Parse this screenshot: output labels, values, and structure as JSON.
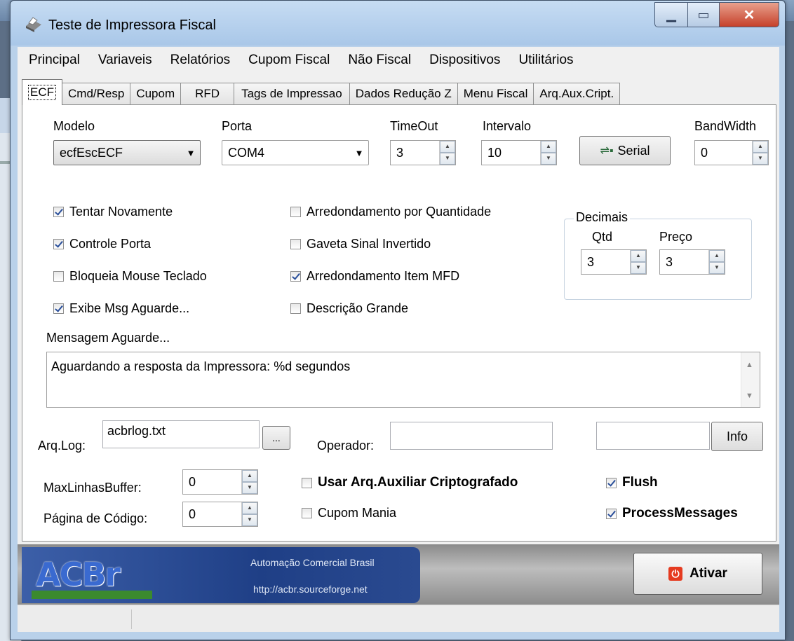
{
  "window": {
    "title": "Teste de Impressora Fiscal"
  },
  "menu": [
    "Principal",
    "Variaveis",
    "Relatórios",
    "Cupom Fiscal",
    "Não Fiscal",
    "Dispositivos",
    "Utilitários"
  ],
  "tabs": [
    "ECF",
    "Cmd/Resp",
    "Cupom",
    "RFD",
    "Tags de Impressao",
    "Dados Redução Z",
    "Menu Fiscal",
    "Arq.Aux.Cript."
  ],
  "ecf": {
    "modelo_label": "Modelo",
    "modelo_value": "ecfEscECF",
    "porta_label": "Porta",
    "porta_value": "COM4",
    "timeout_label": "TimeOut",
    "timeout_value": "3",
    "intervalo_label": "Intervalo",
    "intervalo_value": "10",
    "serial_button": "Serial",
    "bandwidth_label": "BandWidth",
    "bandwidth_value": "0",
    "checks": {
      "tentar": "Tentar Novamente",
      "controle": "Controle Porta",
      "bloqueia": "Bloqueia Mouse Teclado",
      "exibe": "Exibe Msg Aguarde...",
      "arred_qtd": "Arredondamento por Quantidade",
      "gaveta": "Gaveta Sinal Invertido",
      "arred_mfd": "Arredondamento Item MFD",
      "descricao": "Descrição Grande"
    },
    "decimais": {
      "title": "Decimais",
      "qtd_label": "Qtd",
      "qtd_value": "3",
      "preco_label": "Preço",
      "preco_value": "3"
    },
    "mensagem_label": "Mensagem Aguarde...",
    "mensagem_value": "Aguardando a resposta da Impressora: %d segundos",
    "arqlog_label": "Arq.Log:",
    "arqlog_value": "acbrlog.txt",
    "browse_button": "...",
    "operador_label": "Operador:",
    "operador_value": "",
    "info_value": "",
    "info_button": "Info",
    "maxlinhas_label": "MaxLinhasBuffer:",
    "maxlinhas_value": "0",
    "pagina_label": "Página de Código:",
    "pagina_value": "0",
    "usar_arq": "Usar Arq.Auxiliar Criptografado",
    "cupom_mania": "Cupom Mania",
    "flush": "Flush",
    "process": "ProcessMessages"
  },
  "footer": {
    "logo_text": "ACBr",
    "logo_line1": "Automação Comercial Brasil",
    "logo_line2": "http://acbr.sourceforge.net",
    "ativar_button": "Ativar"
  },
  "colors": {
    "titlebar": "#b9d1ea",
    "close": "#c6402a",
    "check": "#2a4f9a",
    "logo_bg": "#1f3f86"
  }
}
